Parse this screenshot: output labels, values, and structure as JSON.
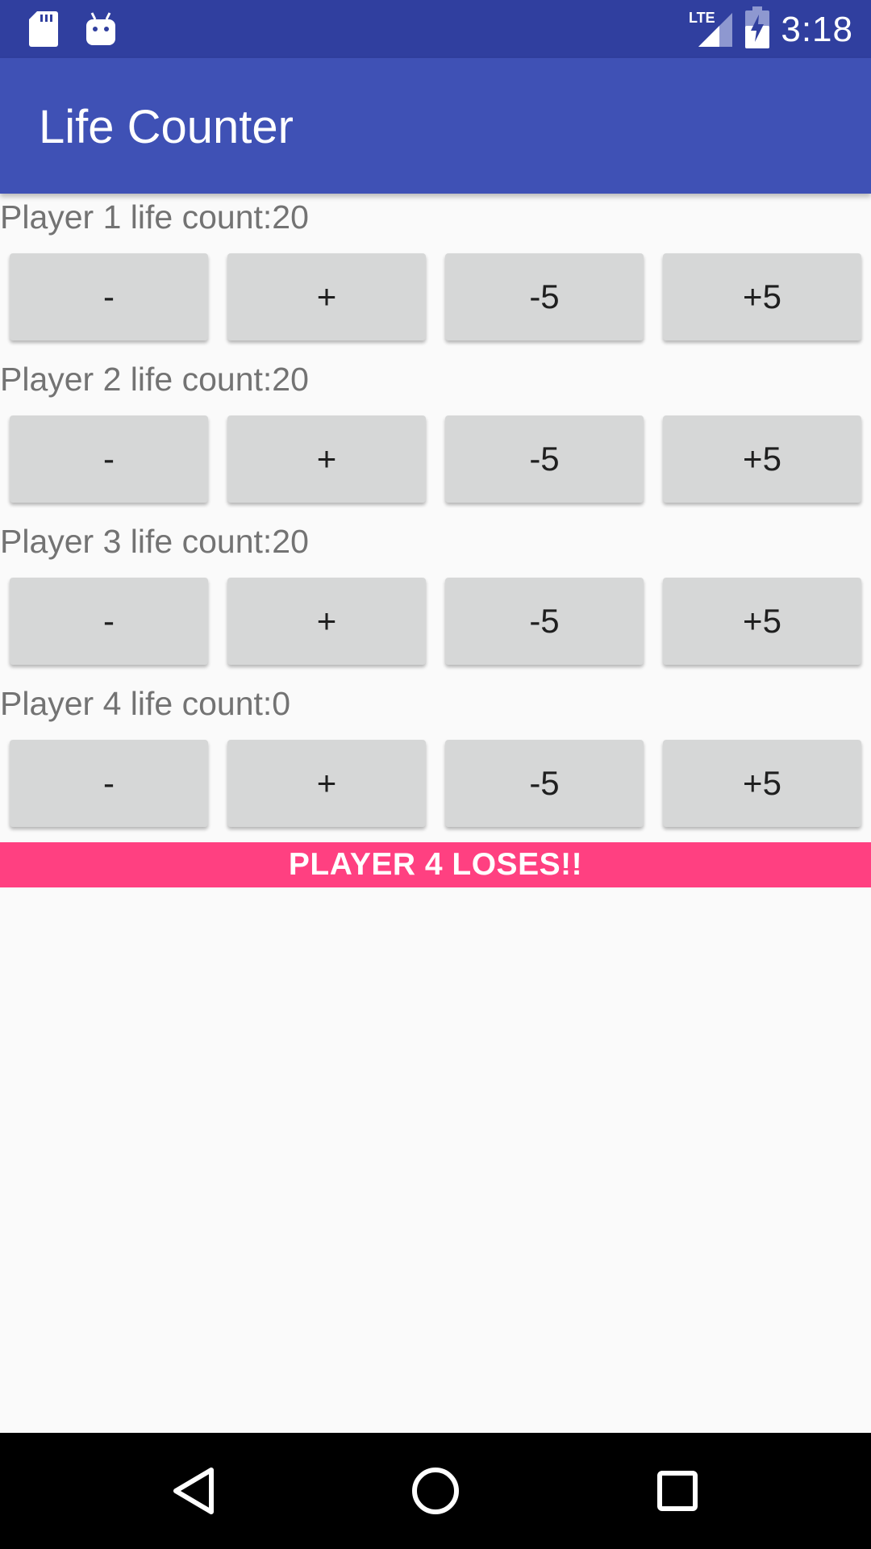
{
  "status_bar": {
    "time": "3:18",
    "network": "LTE",
    "left_icons": [
      "sd-card-icon",
      "android-debug-icon"
    ],
    "right_icons": [
      "lte-signal-icon",
      "battery-charging-icon"
    ]
  },
  "app_bar": {
    "title": "Life Counter",
    "color": "#3f51b5",
    "status_color": "#303f9f"
  },
  "players": [
    {
      "label": "Player 1 life count:20",
      "buttons": [
        "-",
        "+",
        "-5",
        "+5"
      ]
    },
    {
      "label": "Player 2 life count:20",
      "buttons": [
        "-",
        "+",
        "-5",
        "+5"
      ]
    },
    {
      "label": "Player 3 life count:20",
      "buttons": [
        "-",
        "+",
        "-5",
        "+5"
      ]
    },
    {
      "label": "Player 4 life count:0",
      "buttons": [
        "-",
        "+",
        "-5",
        "+5"
      ]
    }
  ],
  "lose_banner": {
    "text": "PLAYER 4 LOSES!!",
    "color": "#ff4081"
  },
  "nav_bar": {
    "buttons": [
      "back-icon",
      "home-icon",
      "recents-icon"
    ]
  }
}
